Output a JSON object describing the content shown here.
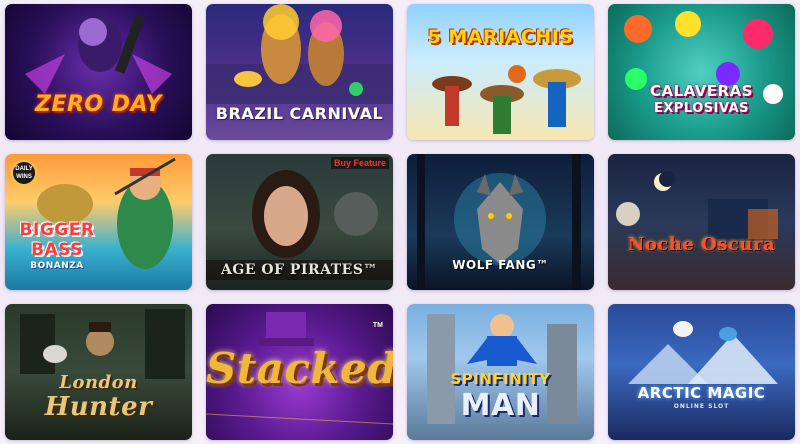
{
  "games": [
    {
      "title": "ZERO DAY"
    },
    {
      "title": "BRAZIL CARNIVAL"
    },
    {
      "title": "5 MARIACHIS"
    },
    {
      "title_line1": "CALAVERAS",
      "title_line2": "EXPLOSIVAS"
    },
    {
      "title_line1": "BIGGER",
      "title_line2": "BASS",
      "subtitle": "BONANZA",
      "badge_line1": "DAILY",
      "badge_line2": "WINS"
    },
    {
      "title": "AGE OF PIRATES™",
      "badge": "Buy Feature"
    },
    {
      "title": "WOLF FANG™"
    },
    {
      "title": "Noche Oscura"
    },
    {
      "title_line1": "London",
      "title_line2": "Hunter"
    },
    {
      "title": "Stacked",
      "tm": "TM"
    },
    {
      "title_line1": "SPINFINITY",
      "title_line2": "MAN"
    },
    {
      "title": "ARCTIC MAGIC",
      "subtitle": "ONLINE SLOT"
    }
  ],
  "colors": {
    "page_bg": "#f2ebf7",
    "zero_day_title": "#ffb020",
    "carnival_title": "#ffffff",
    "mariachis_title": "#ffd21a",
    "calaveras_title": "#ffffff",
    "bass_title": "#ff3b3b",
    "pirates_title": "#e8e4d8",
    "wolf_title": "#ffffff",
    "noche_title": "#ff4d2e",
    "london_title": "#e9c778",
    "stacked_title": "#f0b73a",
    "spinfinity_title": "#ffd23a",
    "arctic_title": "#ffffff"
  }
}
